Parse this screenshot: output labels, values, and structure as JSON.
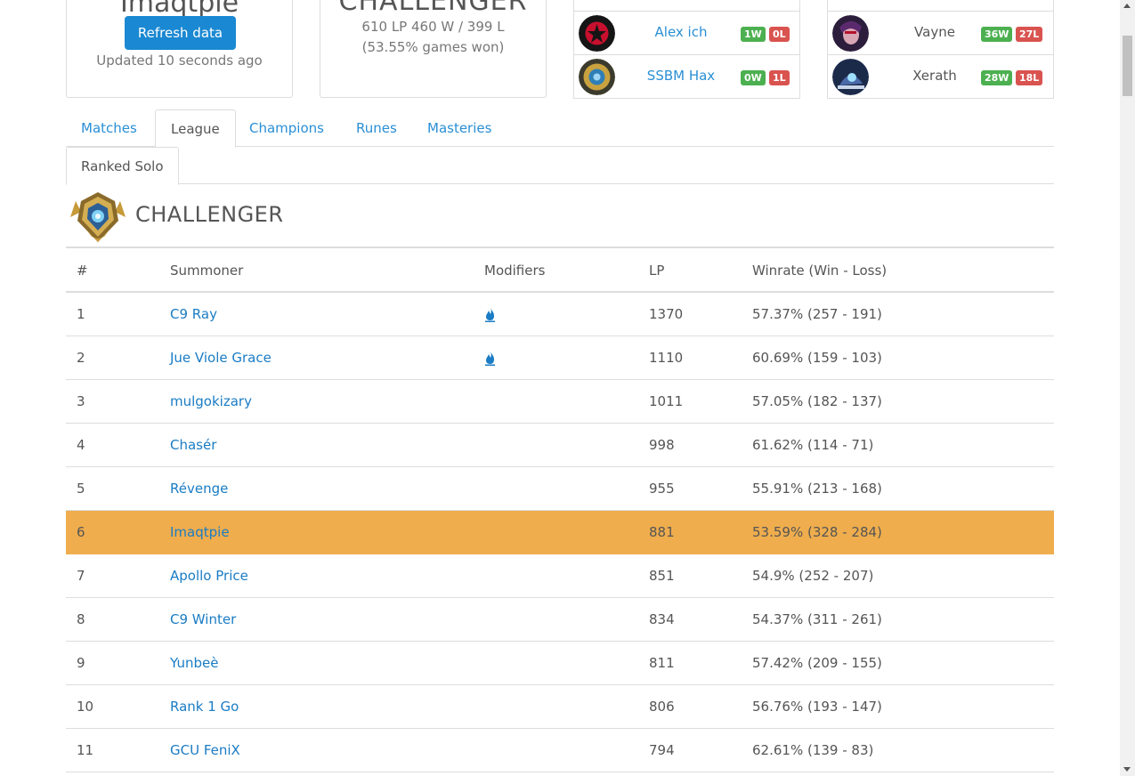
{
  "profile": {
    "name": "Imaqtpie",
    "refresh_label": "Refresh data",
    "updated_text": "Updated 10 seconds ago"
  },
  "rank_summary": {
    "tier": "CHALLENGER",
    "lp_record": "610 LP 460 W / 399 L",
    "winrate_text": "(53.55% games won)"
  },
  "played_with": [
    {
      "name": "Alex ich",
      "wins": "1W",
      "losses": "0L",
      "avatar": "gambit-logo-icon"
    },
    {
      "name": "SSBM Hax",
      "wins": "0W",
      "losses": "1L",
      "avatar": "summoner-icon"
    }
  ],
  "champions": [
    {
      "name": "Vayne",
      "wins": "36W",
      "losses": "27L",
      "avatar": "vayne-portrait-icon"
    },
    {
      "name": "Xerath",
      "wins": "28W",
      "losses": "18L",
      "avatar": "xerath-portrait-icon"
    }
  ],
  "tabs": [
    "Matches",
    "League",
    "Champions",
    "Runes",
    "Masteries"
  ],
  "active_tab": "League",
  "subtab": "Ranked Solo",
  "league": {
    "tier_name": "CHALLENGER",
    "emblem": "challenger-emblem-icon",
    "columns": [
      "#",
      "Summoner",
      "Modifiers",
      "LP",
      "Winrate (Win - Loss)"
    ],
    "rows": [
      {
        "rank": "1",
        "summoner": "C9 Ray",
        "hot_streak": true,
        "lp": "1370",
        "winrate": "57.37% (257 - 191)"
      },
      {
        "rank": "2",
        "summoner": "Jue Viole Grace",
        "hot_streak": true,
        "lp": "1110",
        "winrate": "60.69% (159 - 103)"
      },
      {
        "rank": "3",
        "summoner": "mulgokizary",
        "hot_streak": false,
        "lp": "1011",
        "winrate": "57.05% (182 - 137)"
      },
      {
        "rank": "4",
        "summoner": "Chasér",
        "hot_streak": false,
        "lp": "998",
        "winrate": "61.62% (114 - 71)"
      },
      {
        "rank": "5",
        "summoner": "Révenge",
        "hot_streak": false,
        "lp": "955",
        "winrate": "55.91% (213 - 168)"
      },
      {
        "rank": "6",
        "summoner": "Imaqtpie",
        "hot_streak": false,
        "lp": "881",
        "winrate": "53.59% (328 - 284)",
        "highlight": true
      },
      {
        "rank": "7",
        "summoner": "Apollo Price",
        "hot_streak": false,
        "lp": "851",
        "winrate": "54.9% (252 - 207)"
      },
      {
        "rank": "8",
        "summoner": "C9 Winter",
        "hot_streak": false,
        "lp": "834",
        "winrate": "54.37% (311 - 261)"
      },
      {
        "rank": "9",
        "summoner": "Yunbeè",
        "hot_streak": false,
        "lp": "811",
        "winrate": "57.42% (209 - 155)"
      },
      {
        "rank": "10",
        "summoner": "Rank 1 Go",
        "hot_streak": false,
        "lp": "806",
        "winrate": "56.76% (193 - 147)"
      },
      {
        "rank": "11",
        "summoner": "GCU FeniX",
        "hot_streak": false,
        "lp": "794",
        "winrate": "62.61% (139 - 83)"
      }
    ]
  },
  "colors": {
    "link": "#1a7cc4",
    "primary_button": "#1a88d2",
    "highlight_row": "#efad4d",
    "win_badge": "#4cb050",
    "loss_badge": "#d9534f"
  }
}
